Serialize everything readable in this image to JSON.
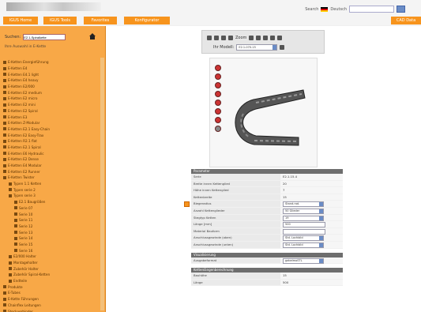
{
  "header": {
    "search_label": "Search",
    "language_label": "Deutsch",
    "go_label": "",
    "colors": {
      "tab": "#f7941d",
      "sidebar": "#f8a847",
      "section_header": "#6e6e6e"
    }
  },
  "nav": {
    "tabs": [
      "IGUS Home",
      "IGUS Tools",
      "Favorites",
      "Konfigurator"
    ],
    "right_tab": "CAD Data"
  },
  "sidebar": {
    "search_label": "Suchen:",
    "search_value": "E2.1-Spiralkette",
    "note": "Ihre Auswahl in E-Kette",
    "tree": [
      "E-Ketten Energieführung",
      "E-Ketten E4",
      "E-Ketten E4.1 light",
      "E-Ketten E4 heavy",
      "E-Ketten E2/000",
      "E-Ketten E2 medium",
      "E-Ketten E2 micro",
      "E-Ketten E2 mini",
      "E-Ketten E2 Spiral",
      "E-Ketten E3",
      "E-Ketten Z-Modular",
      "E-Ketten E2.1 Easy-Chain",
      "E-Ketten E2 Easy-Trax",
      "E-Ketten R2.1 flat",
      "E-Ketten E2.1 Spiral",
      "E-Ketten E6 Hydraulic",
      "E-Ketten E2 Dense",
      "E-Ketten E4 Modular",
      "E-Ketten E2 Runner",
      "E-Ketten Twister",
      "Typen 1.1 Ketten",
      "Typen serie 2",
      "Typen serie 3",
      "E2.1 Baugrößen",
      "Serie 07",
      "Serie 10",
      "Serie 11",
      "Serie 12",
      "Serie 13",
      "Serie 14",
      "Serie 15",
      "Serie 16",
      "E2/000 Halter",
      "Montagehalter",
      "Zubehör Halter",
      "Zubehör Spiral-Ketten",
      "Endteile",
      "Produkte",
      "E-Tubes",
      "E-Kette Führungen",
      "Chainflex Leitungen",
      "Steckverbinder",
      "Schutzschlauch"
    ]
  },
  "toolbar": {
    "zoom_label": "Zoom",
    "model_label": "Ihr Modell:",
    "model_value": "E2.1-070-15"
  },
  "props": {
    "section1_title": "Parameter",
    "rows1": [
      {
        "k": "Serie",
        "v": "E2.1.15.4"
      },
      {
        "k": "Breite innen Kettenglied",
        "v": "20"
      },
      {
        "k": "Höhe innen Kettenglied",
        "v": "7"
      },
      {
        "k": "Kettenbreite",
        "v": "15"
      },
      {
        "k": "Biegeradius",
        "v": "Stand.rad.",
        "ctl": "sel"
      },
      {
        "k": "Anzahl Kettenglieder",
        "v": "50 Glieder",
        "ctl": "sel"
      },
      {
        "k": "Stegtyp Ketten",
        "v": "19",
        "ctl": "sel"
      },
      {
        "k": "Länge [mm]",
        "v": "500",
        "ctl": "txt"
      },
      {
        "k": "Material Bauform",
        "v": "",
        "ctl": "txt"
      },
      {
        "k": "Anschlussgewinde (oben)",
        "v": "Std. Lochbild",
        "ctl": "sel"
      },
      {
        "k": "Anschlussgewinde (unten)",
        "v": "Std. Lochbild",
        "ctl": "sel"
      }
    ],
    "section2_title": "Visualisierung",
    "rows2": [
      {
        "k": "Ausgabeformat",
        "v": "gabelmoSTL",
        "ctl": "sel"
      }
    ],
    "section3_title": "Kettenlängenberechnung",
    "rows3": [
      {
        "k": "Bauhöhe",
        "v": "15"
      },
      {
        "k": "Länge",
        "v": "500"
      }
    ]
  }
}
